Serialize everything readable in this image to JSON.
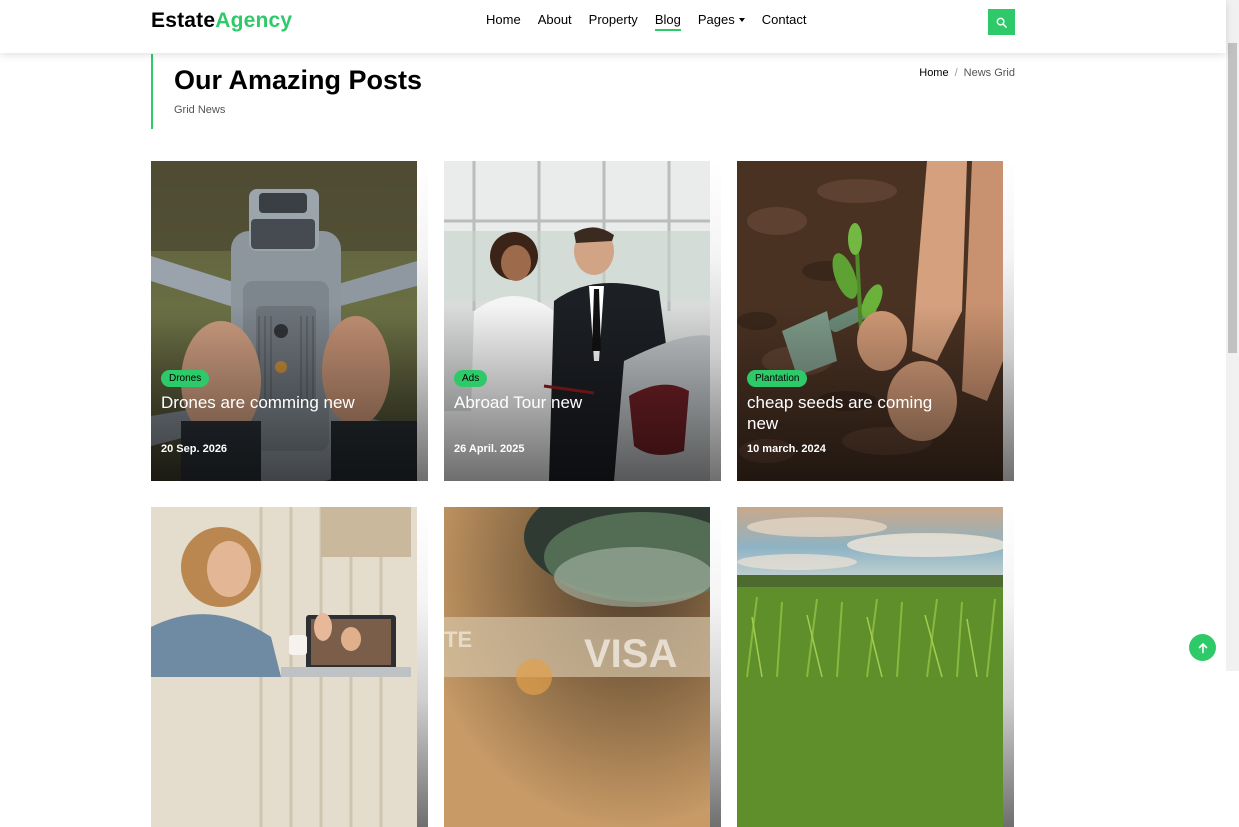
{
  "brand": {
    "part1": "Estate",
    "part2": "Agency",
    "accent_color": "#2eca6a"
  },
  "nav": {
    "items": [
      {
        "label": "Home",
        "active": false
      },
      {
        "label": "About",
        "active": false
      },
      {
        "label": "Property",
        "active": false
      },
      {
        "label": "Blog",
        "active": true
      },
      {
        "label": "Pages",
        "active": false,
        "dropdown": true
      },
      {
        "label": "Contact",
        "active": false
      }
    ],
    "search_icon": "search-icon"
  },
  "intro": {
    "title": "Our Amazing Posts",
    "subtitle": "Grid News",
    "breadcrumb": {
      "home": "Home",
      "separator": "/",
      "current": "News Grid"
    }
  },
  "posts": [
    {
      "category": "Drones",
      "title": "Drones are comming new",
      "date": "20 Sep. 2026",
      "image": "hand-holding-drone"
    },
    {
      "category": "Ads",
      "title": "Abroad Tour new",
      "date": "26 April. 2025",
      "image": "couple-at-car-dealership"
    },
    {
      "category": "Plantation",
      "title": "cheap seeds are coming new",
      "date": "10 march. 2024",
      "image": "hands-planting-seedling"
    },
    {
      "category": "",
      "title": "",
      "date": "",
      "image": "woman-on-video-call"
    },
    {
      "category": "",
      "title": "",
      "date": "",
      "image": "credit-card-closeup"
    },
    {
      "category": "",
      "title": "",
      "date": "",
      "image": "green-crop-field"
    }
  ],
  "back_to_top_icon": "arrow-up-icon"
}
